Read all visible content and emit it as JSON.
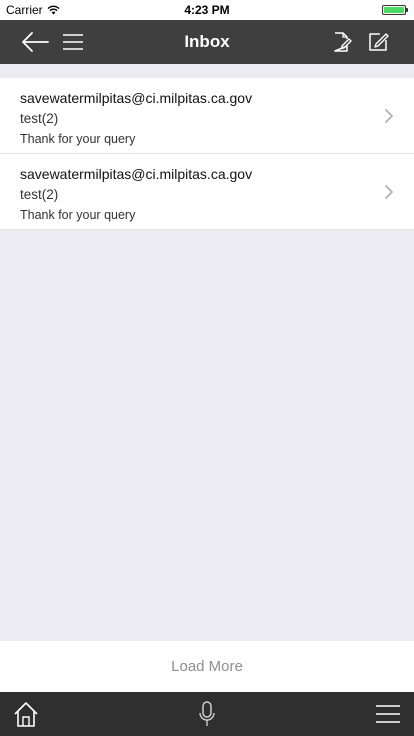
{
  "status_bar": {
    "carrier": "Carrier",
    "time": "4:23 PM"
  },
  "nav": {
    "title": "Inbox"
  },
  "messages": [
    {
      "from": "savewatermilpitas@ci.milpitas.ca.gov",
      "subject": "test(2)",
      "preview": "Thank for your query"
    },
    {
      "from": "savewatermilpitas@ci.milpitas.ca.gov",
      "subject": "test(2)",
      "preview": "Thank for your query"
    }
  ],
  "footer": {
    "load_more_label": "Load More"
  },
  "colors": {
    "nav_background": "#3f3f3f",
    "tab_background": "#2f2f2f",
    "page_background": "#ecebf2",
    "battery": "#4cd964"
  }
}
